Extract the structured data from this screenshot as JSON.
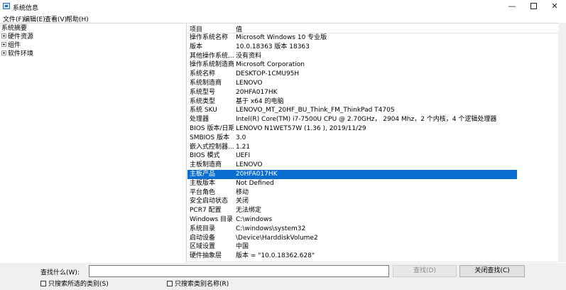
{
  "window": {
    "title": "系统信息",
    "icon": "system-info-icon"
  },
  "menu": [
    "文件(F)",
    "编辑(E)",
    "查看(V)",
    "帮助(H)"
  ],
  "tree": {
    "root": "系统摘要",
    "children": [
      "硬件资源",
      "组件",
      "软件环境"
    ]
  },
  "columns": {
    "item": "项目",
    "value": "值"
  },
  "rows": [
    {
      "k": "操作系统名称",
      "v": "Microsoft Windows 10 专业版"
    },
    {
      "k": "版本",
      "v": "10.0.18363 版本 18363"
    },
    {
      "k": "其他操作系统...",
      "v": "没有资料"
    },
    {
      "k": "操作系统制造商",
      "v": "Microsoft Corporation"
    },
    {
      "k": "系统名称",
      "v": "DESKTOP-1CMU95H"
    },
    {
      "k": "系统制造商",
      "v": "LENOVO"
    },
    {
      "k": "系统型号",
      "v": "20HFA017HK"
    },
    {
      "k": "系统类型",
      "v": "基于 x64 的电脑"
    },
    {
      "k": "系统 SKU",
      "v": "LENOVO_MT_20HF_BU_Think_FM_ThinkPad T470S"
    },
    {
      "k": "处理器",
      "v": "Intel(R) Core(TM) i7-7500U CPU @ 2.70GHz， 2904 Mhz，2 个内核，4 个逻辑处理器"
    },
    {
      "k": "BIOS 版本/日期",
      "v": "LENOVO N1WET57W (1.36 ), 2019/11/29"
    },
    {
      "k": "SMBIOS 版本",
      "v": "3.0"
    },
    {
      "k": "嵌入式控制器...",
      "v": "1.21"
    },
    {
      "k": "BIOS 模式",
      "v": "UEFI"
    },
    {
      "k": "主板制造商",
      "v": "LENOVO"
    },
    {
      "k": "主板产品",
      "v": "20HFA017HK",
      "selected": true
    },
    {
      "k": "主板版本",
      "v": "Not Defined"
    },
    {
      "k": "平台角色",
      "v": "移动"
    },
    {
      "k": "安全启动状态",
      "v": "关闭"
    },
    {
      "k": "PCR7 配置",
      "v": "无法绑定"
    },
    {
      "k": "Windows 目录",
      "v": "C:\\windows"
    },
    {
      "k": "系统目录",
      "v": "C:\\windows\\system32"
    },
    {
      "k": "启动设备",
      "v": "\\Device\\HarddiskVolume2"
    },
    {
      "k": "区域设置",
      "v": "中国"
    },
    {
      "k": "硬件抽象层",
      "v": "版本 = \"10.0.18362.628\""
    }
  ],
  "find": {
    "label": "查找什么(W):",
    "value": "",
    "placeholder": "",
    "find_button": "查找(D)",
    "close_button": "关闭查找(C)",
    "check_selected": "只搜索所选的类别(S)",
    "check_names": "只搜索类别名称(R)"
  }
}
